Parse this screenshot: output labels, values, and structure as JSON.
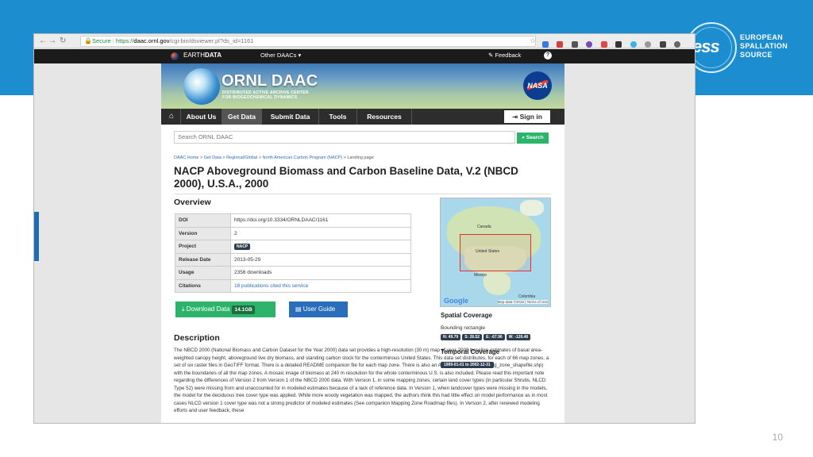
{
  "slide": {
    "page_number": "10",
    "logo": {
      "mark": "ess",
      "name_lines": [
        "EUROPEAN",
        "SPALLATION",
        "SOURCE"
      ]
    },
    "accent_color": "#1c8ed0"
  },
  "browser": {
    "secure_label": "Secure",
    "url_scheme": "https://",
    "url_host": "daac.ornl.gov",
    "url_path": "/cgi-bin/dsviewer.pl?ds_id=1161"
  },
  "earthdata_bar": {
    "brand_prefix": "EARTH",
    "brand_suffix": "DATA",
    "other_daacs": "Other DAACs ▾",
    "feedback": "Feedback",
    "help": "?"
  },
  "banner": {
    "title": "ORNL DAAC",
    "subtitle_lines": [
      "DISTRIBUTED ACTIVE ARCHIVE CENTER",
      "FOR BIOGEOCHEMICAL DYNAMICS"
    ],
    "agency": "NASA"
  },
  "nav": {
    "items": [
      {
        "label": "About Us"
      },
      {
        "label": "Get Data"
      },
      {
        "label": "Submit Data"
      },
      {
        "label": "Tools"
      },
      {
        "label": "Resources"
      }
    ],
    "signin": "Sign in"
  },
  "search": {
    "placeholder": "Search ORNL DAAC",
    "button": "Search"
  },
  "breadcrumb": {
    "items": [
      "DAAC Home",
      "Get Data",
      "Regional/Global",
      "North American Carbon Program (NACP)"
    ],
    "current": "Landing page"
  },
  "dataset": {
    "title": "NACP Aboveground Biomass and Carbon Baseline Data, V.2 (NBCD 2000), U.S.A., 2000",
    "overview_heading": "Overview",
    "overview": {
      "doi_label": "DOI",
      "doi": "https://doi.org/10.3334/ORNLDAAC/1161",
      "version_label": "Version",
      "version": "2",
      "project_label": "Project",
      "project": "NACP",
      "release_label": "Release Date",
      "release": "2013-05-29",
      "usage_label": "Usage",
      "usage": "2356 downloads",
      "citations_label": "Citations",
      "citations": "18 publications cited this service"
    },
    "download_label": "Download Data",
    "download_size": "14.1GB",
    "user_guide_label": "User Guide",
    "description_heading": "Description",
    "description": "The NBCD 2000 (National Biomass and Carbon Dataset for the Year 2000) data set provides a high-resolution (30 m) map of year-2000 baseline estimates of basal area-weighted canopy height, aboveground live dry biomass, and standing carbon stock for the conterminous United States. This data set distributes, for each of 66 map zones, a set of six raster files in GeoTIFF format. There is a detailed README companion file for each map zone. There is also an ArcGIS shapefile (mapping_zone_shapefile.shp) with the boundaries of all the map zones. A mosaic image of biomass at 240 m resolution for the whole conterminous U.S. is also included. Please read this important note regarding the differences of Version 2 from Version 1 of the NBCD 2000 data. With Version 1, in some mapping zones, certain land cover types (in particular Shrubs, NLCD Type 52) were missing from and unaccounted for in modeled estimates because of a lack of reference data. In Version 1, when landcover types were missing in the models, the model for the deciduous tree cover type was applied. While more woody vegetation was mapped, the authors think this had little effect on model performance as in most cases NLCD version 1 cover type was not a strong predictor of modeled estimates (See companion Mapping Zone Roadmap files). In Version 2, after renewed modeling efforts and user feedback, these"
  },
  "map": {
    "labels": {
      "canada": "Canada",
      "us": "United States",
      "mexico": "Mexico",
      "colombia": "Colombia"
    },
    "google": "Google",
    "copyright": "Map data ©2018 | Terms of Use"
  },
  "spatial": {
    "heading": "Spatial Coverage",
    "sub": "Bounding rectangle",
    "coords": [
      "N: 49.79",
      "S: 26.52",
      "E: -67.96",
      "W: -126.46"
    ]
  },
  "temporal": {
    "heading": "Temporal Coverage",
    "range": "1999-01-01 to 2002-12-31"
  }
}
